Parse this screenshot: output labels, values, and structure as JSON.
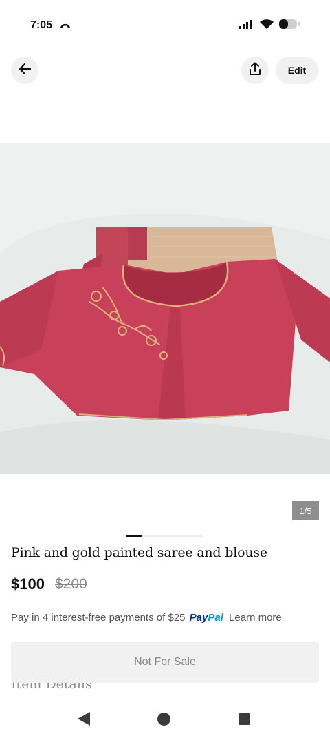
{
  "status": {
    "time": "7:05"
  },
  "header": {
    "edit_label": "Edit"
  },
  "gallery": {
    "counter": "1/5",
    "current_index": 1,
    "total": 5
  },
  "listing": {
    "title": "Pink and gold painted saree and blouse",
    "price": "$100",
    "original_price": "$200"
  },
  "payment": {
    "text": "Pay in 4 interest-free payments of $25",
    "paypal_pay": "Pay",
    "paypal_pal": "Pal",
    "learn_more": "Learn more"
  },
  "details": {
    "heading": "Item Details"
  },
  "actions": {
    "not_for_sale_label": "Not For Sale"
  },
  "colors": {
    "blouse": "#c9405a",
    "saree_gold": "#d9b89a",
    "paypal_dark": "#003087",
    "paypal_light": "#009cde"
  }
}
